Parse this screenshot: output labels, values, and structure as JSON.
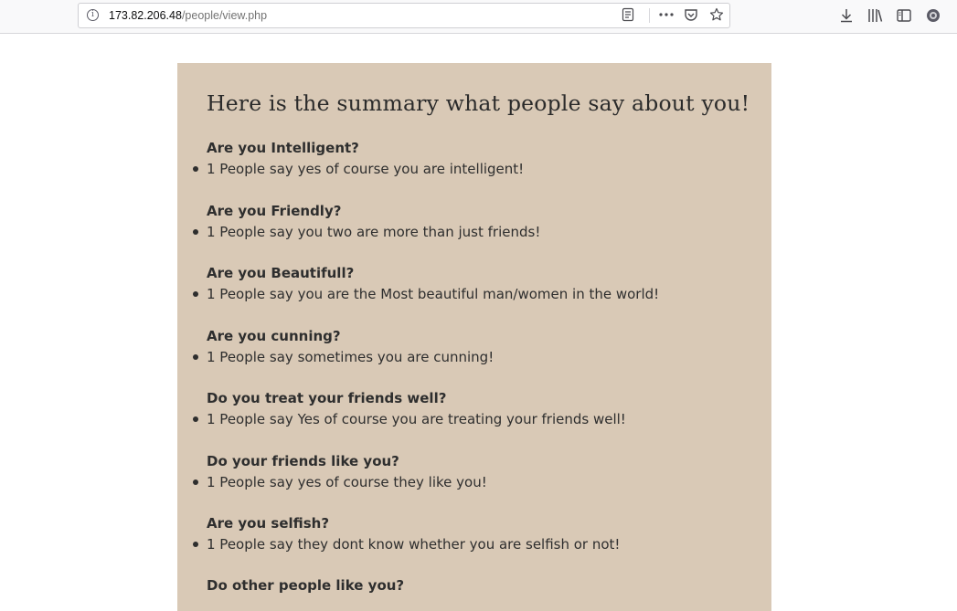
{
  "browser": {
    "url_host": "173.82.206.48",
    "url_path": "/people/view.php"
  },
  "page": {
    "title": "Here is the summary what people say about you!",
    "items": [
      {
        "question": "Are you Intelligent?",
        "answer": "1 People say yes of course you are intelligent!"
      },
      {
        "question": "Are you Friendly?",
        "answer": "1 People say you two are more than just friends!"
      },
      {
        "question": "Are you Beautifull?",
        "answer": "1 People say you are the Most beautiful man/women in the world!"
      },
      {
        "question": "Are you cunning?",
        "answer": "1 People say sometimes you are cunning!"
      },
      {
        "question": "Do you treat your friends well?",
        "answer": "1 People say Yes of course you are treating your friends well!"
      },
      {
        "question": "Do your friends like you?",
        "answer": "1 People say yes of course they like you!"
      },
      {
        "question": "Are you selfish?",
        "answer": "1 People say they dont know whether you are selfish or not!"
      },
      {
        "question": "Do other people like you?"
      }
    ]
  }
}
